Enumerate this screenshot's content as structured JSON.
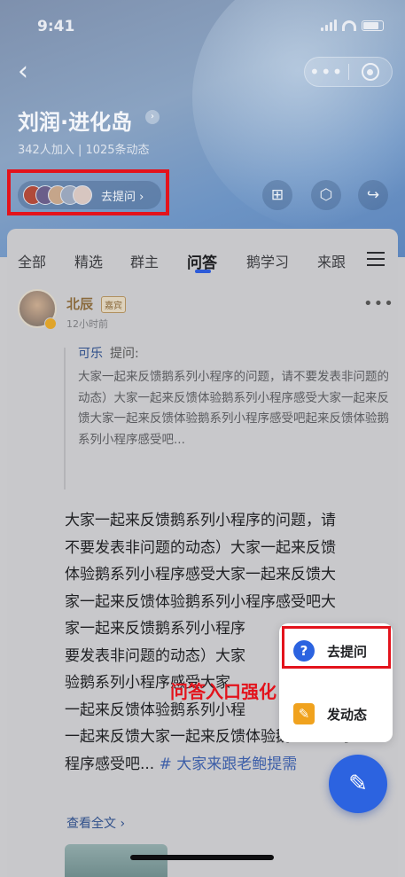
{
  "status_bar": {
    "time": "9:41"
  },
  "header": {
    "title": "刘润·进化岛",
    "stats": "342人加入 | 1025条动态",
    "ask_label": "去提问 ›",
    "avatar_colors": [
      "#b04a3a",
      "#6a5e8a",
      "#c5a58a",
      "#9aa7bd",
      "#d7c6c0"
    ]
  },
  "tabs": [
    "全部",
    "精选",
    "群主",
    "问答",
    "鹅学习",
    "来跟"
  ],
  "active_tab": "问答",
  "post": {
    "author": "北辰",
    "badge": "嘉宾",
    "time": "12小时前",
    "quote_author": "可乐",
    "quote_verb": "提问:",
    "quote_text": "大家一起来反馈鹅系列小程序的问题，请不要发表非问题的动态）大家一起来反馈体验鹅系列小程序感受大家一起来反馈大家一起来反馈体验鹅系列小程序感受吧起来反馈体验鹅系列小程序感受吧...",
    "body_line1": "大家一起来反馈鹅系列小程序的问题，请",
    "body_line2": "不要发表非问题的动态）大家一起来反馈",
    "body_line3": "体验鹅系列小程序感受大家一起来反馈大",
    "body_line4": "家一起来反馈体验鹅系列小程序感受吧大",
    "body_line5": "家一起来反馈鹅系列小程序",
    "body_line6": "要发表非问题的动态）大家",
    "body_line7": "验鹅系列小程序感受大家",
    "body_line8": "一起来反馈体验鹅系列小程",
    "body_line9": "一起来反馈大家一起来反馈体验鹅",
    "body_line9_tail": "小",
    "body_line10": "程序感受吧...",
    "hashtag": "# 大家来跟老鲍提需",
    "read_more": "查看全文 ›"
  },
  "popup": {
    "ask": "去提问",
    "post": "发动态"
  },
  "annotation": "问答入口强化",
  "colors": {
    "accent_blue": "#2c63e0",
    "annotation_red": "#e3131c"
  }
}
